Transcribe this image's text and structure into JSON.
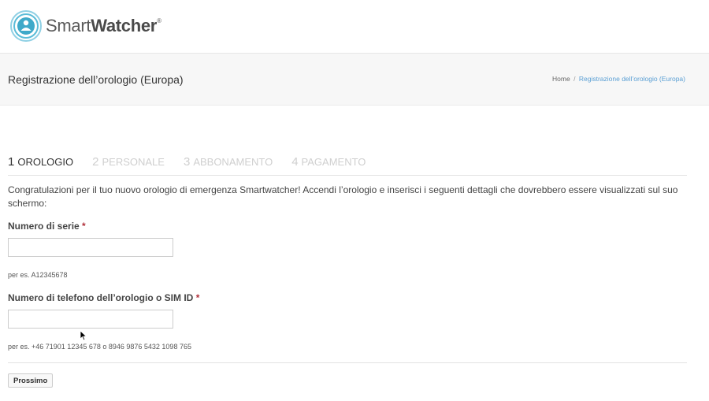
{
  "header": {
    "brand_light": "Smart",
    "brand_bold": "Watcher",
    "brand_mark": "®",
    "logo_icon": "smartwatcher-logo-icon"
  },
  "titlebar": {
    "title": "Registrazione dell’orologio (Europa)",
    "breadcrumb": {
      "home": "Home",
      "separator": "/",
      "current": "Registrazione dell’orologio (Europa)"
    }
  },
  "steps": [
    {
      "num": "1",
      "label": "OROLOGIO",
      "active": true
    },
    {
      "num": "2",
      "label": "PERSONALE",
      "active": false
    },
    {
      "num": "3",
      "label": "ABBONAMENTO",
      "active": false
    },
    {
      "num": "4",
      "label": "PAGAMENTO",
      "active": false
    }
  ],
  "form": {
    "intro": "Congratulazioni per il tuo nuovo orologio di emergenza Smartwatcher! Accendi l’orologio e inserisci i seguenti dettagli che dovrebbero essere visualizzati sul suo schermo:",
    "serial": {
      "label": "Numero di serie",
      "required_mark": "*",
      "value": "",
      "hint": "per es. A12345678"
    },
    "phone": {
      "label": "Numero di telefono dell’orologio o SIM ID",
      "required_mark": "*",
      "value": "",
      "hint": "per es. +46 71901 12345 678 o 8946 9876 5432 1098 765"
    },
    "next_label": "Prossimo"
  },
  "colors": {
    "accent": "#5a9fd4",
    "required": "#b0303a",
    "inactive_step": "#cfcfcf",
    "logo_teal": "#3fa9c9"
  }
}
